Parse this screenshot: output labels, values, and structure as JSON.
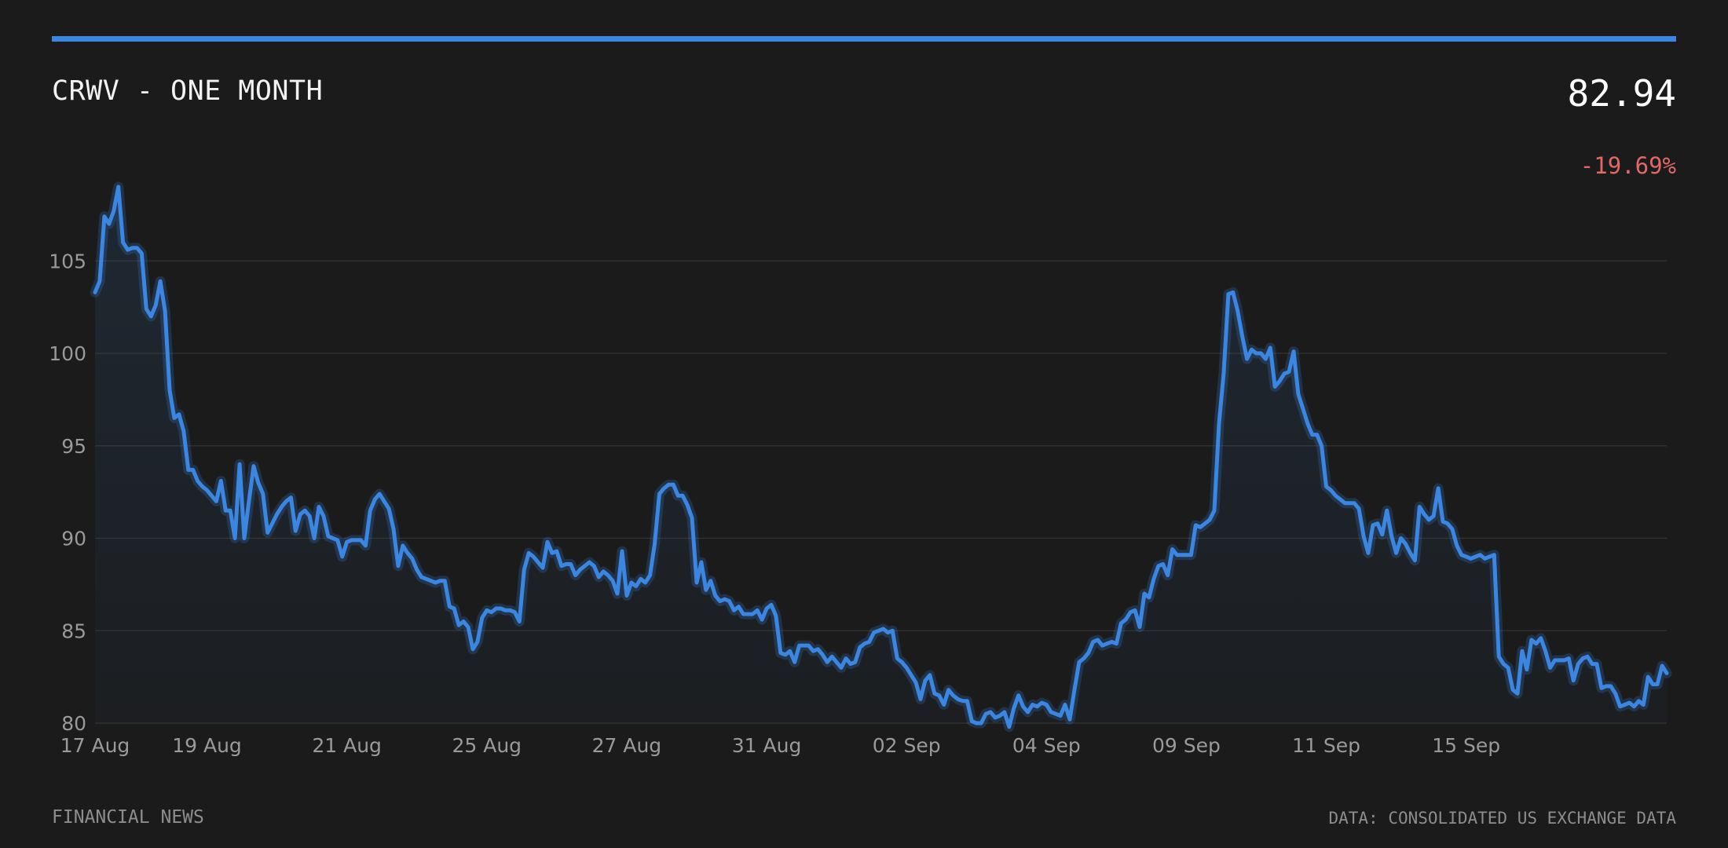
{
  "header": {
    "title": "CRWV - ONE MONTH",
    "price": "82.94",
    "change": "-19.69%"
  },
  "footer": {
    "left": "FINANCIAL NEWS",
    "right": "DATA: CONSOLIDATED US EXCHANGE DATA"
  },
  "colors": {
    "background": "#1b1b1b",
    "accent": "#3a86e0",
    "negative": "#e26868",
    "grid": "#333333",
    "tick_text": "#9a9a9a"
  },
  "chart_data": {
    "type": "area",
    "title": "CRWV - ONE MONTH",
    "xlabel": "",
    "ylabel": "",
    "grid": true,
    "ylim": [
      80,
      110
    ],
    "yticks": [
      80,
      85,
      90,
      95,
      100,
      105
    ],
    "xticks": [
      {
        "index": 0,
        "label": "17 Aug"
      },
      {
        "index": 24,
        "label": "19 Aug"
      },
      {
        "index": 54,
        "label": "21 Aug"
      },
      {
        "index": 84,
        "label": "25 Aug"
      },
      {
        "index": 114,
        "label": "27 Aug"
      },
      {
        "index": 144,
        "label": "31 Aug"
      },
      {
        "index": 174,
        "label": "02 Sep"
      },
      {
        "index": 204,
        "label": "04 Sep"
      },
      {
        "index": 234,
        "label": "09 Sep"
      },
      {
        "index": 264,
        "label": "11 Sep"
      },
      {
        "index": 294,
        "label": "15 Sep"
      }
    ],
    "values": [
      103.3,
      103.9,
      107.4,
      107.0,
      107.7,
      109.0,
      106.0,
      105.6,
      105.7,
      105.7,
      105.4,
      102.4,
      102.0,
      102.6,
      103.9,
      102.3,
      98.0,
      96.5,
      96.7,
      95.8,
      93.7,
      93.7,
      93.1,
      92.8,
      92.6,
      92.3,
      92.0,
      93.1,
      91.5,
      91.5,
      90.0,
      94.0,
      90.0,
      92.0,
      93.9,
      93.0,
      92.4,
      90.3,
      90.8,
      91.3,
      91.7,
      92.0,
      92.2,
      90.4,
      91.3,
      91.5,
      91.2,
      90.0,
      91.7,
      91.2,
      90.1,
      90.0,
      89.9,
      89.0,
      89.8,
      89.9,
      89.9,
      89.9,
      89.6,
      91.5,
      92.1,
      92.4,
      92.0,
      91.6,
      90.5,
      88.5,
      89.6,
      89.2,
      88.9,
      88.3,
      87.9,
      87.8,
      87.7,
      87.6,
      87.7,
      87.7,
      86.3,
      86.2,
      85.3,
      85.5,
      85.2,
      84.0,
      84.4,
      85.7,
      86.1,
      86.0,
      86.2,
      86.2,
      86.1,
      86.1,
      86.0,
      85.5,
      88.3,
      89.2,
      89.0,
      88.7,
      88.4,
      89.8,
      89.2,
      89.3,
      88.5,
      88.6,
      88.6,
      88.0,
      88.3,
      88.5,
      88.7,
      88.5,
      87.9,
      88.2,
      88.0,
      87.7,
      87.0,
      89.3,
      86.9,
      87.6,
      87.4,
      87.8,
      87.6,
      88.0,
      89.7,
      92.4,
      92.7,
      92.9,
      92.9,
      92.3,
      92.3,
      91.8,
      91.1,
      87.6,
      88.7,
      87.2,
      87.7,
      86.9,
      86.6,
      86.7,
      86.6,
      86.1,
      86.3,
      85.9,
      85.9,
      85.9,
      86.1,
      85.6,
      86.2,
      86.4,
      85.8,
      83.8,
      83.7,
      83.9,
      83.3,
      84.2,
      84.2,
      84.2,
      83.9,
      84.0,
      83.7,
      83.3,
      83.6,
      83.3,
      83.0,
      83.5,
      83.2,
      83.3,
      84.1,
      84.3,
      84.4,
      84.9,
      85.0,
      85.1,
      84.9,
      85.0,
      83.5,
      83.3,
      83.0,
      82.6,
      82.2,
      81.3,
      82.3,
      82.6,
      81.6,
      81.5,
      81.0,
      81.8,
      81.5,
      81.3,
      81.2,
      81.2,
      80.1,
      80.0,
      80.0,
      80.5,
      80.6,
      80.3,
      80.4,
      80.6,
      79.8,
      80.8,
      81.5,
      80.9,
      80.6,
      81.0,
      80.9,
      81.1,
      81.0,
      80.6,
      80.5,
      80.4,
      81.0,
      80.2,
      81.8,
      83.3,
      83.5,
      83.8,
      84.4,
      84.5,
      84.2,
      84.3,
      84.4,
      84.3,
      85.4,
      85.6,
      86.0,
      86.1,
      85.2,
      87.0,
      86.8,
      87.8,
      88.5,
      88.6,
      88.0,
      89.4,
      89.1,
      89.1,
      89.1,
      89.1,
      90.7,
      90.6,
      90.8,
      91.0,
      91.5,
      96.2,
      98.9,
      103.2,
      103.3,
      102.3,
      100.9,
      99.7,
      100.2,
      100.0,
      100.0,
      99.7,
      100.3,
      98.2,
      98.5,
      98.9,
      99.0,
      100.1,
      97.8,
      97.0,
      96.2,
      95.6,
      95.6,
      95.0,
      92.8,
      92.6,
      92.3,
      92.1,
      91.9,
      91.9,
      91.9,
      91.6,
      90.1,
      89.2,
      90.7,
      90.8,
      90.2,
      91.5,
      90.1,
      89.2,
      90.0,
      89.7,
      89.2,
      88.8,
      91.7,
      91.3,
      91.0,
      91.2,
      92.7,
      90.9,
      90.8,
      90.5,
      89.6,
      89.1,
      89.0,
      88.9,
      89.0,
      89.1,
      88.9,
      89.0,
      89.1,
      83.6,
      83.2,
      83.0,
      81.8,
      81.6,
      83.9,
      82.9,
      84.5,
      84.3,
      84.6,
      83.9,
      83.0,
      83.4,
      83.4,
      83.4,
      83.5,
      82.3,
      83.2,
      83.5,
      83.6,
      83.2,
      83.2,
      81.9,
      82.0,
      82.0,
      81.6,
      80.9,
      81.0,
      81.1,
      80.9,
      81.2,
      81.0,
      82.5,
      82.1,
      82.1,
      83.1,
      82.7
    ]
  }
}
